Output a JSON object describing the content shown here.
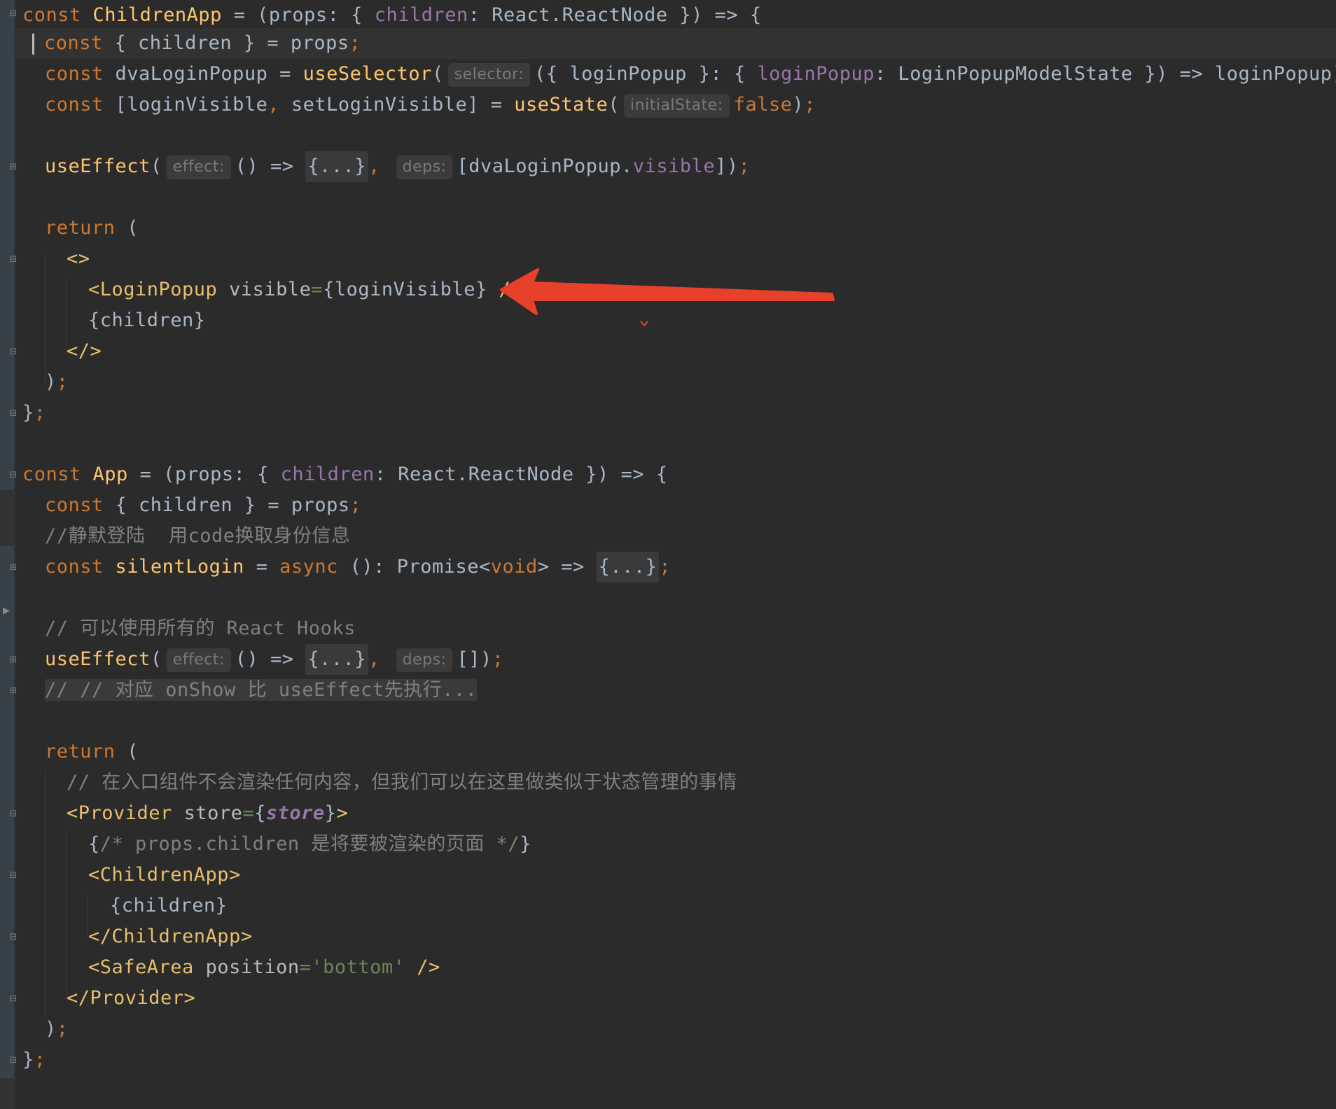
{
  "colors": {
    "background": "#2b2b2b",
    "keyword": "#cc7832",
    "function": "#ffc66d",
    "property": "#9876aa",
    "string": "#6a8759",
    "comment": "#808080",
    "tag": "#e8bf6a",
    "annotation_arrow": "#e8412b"
  },
  "hints": {
    "selector": "selector:",
    "initialState": "initialState:",
    "effect": "effect:",
    "deps": "deps:"
  },
  "code": {
    "l1": {
      "kw": "const",
      "name": "ChildrenApp",
      "a": " = (props: { ",
      "prop": "children",
      "b": ": React.ReactNode }) => {"
    },
    "l2": {
      "kw": "const",
      "a": " { children } = props",
      "semi": ";"
    },
    "l3": {
      "kw": "const",
      "a": " dvaLoginPopup = ",
      "fn": "useSelector",
      "b": "(",
      "c": "({ loginPopup }: { ",
      "prop": "loginPopup",
      "d": ": LoginPopupModelState }) => loginPopup)",
      "semi": ";"
    },
    "l4": {
      "kw": "const",
      "a": " [loginVisible",
      "comma": ",",
      "b": " setLoginVisible] = ",
      "fn": "useState",
      "c": "(",
      "val": "false",
      "d": ")",
      "semi": ";"
    },
    "l5": {
      "fn": "useEffect",
      "a": "(",
      "b": "() => ",
      "folded": "{...}",
      "comma": ",",
      "c": "[dvaLoginPopup.",
      "prop": "visible",
      "d": "])",
      "semi": ";"
    },
    "l6": {
      "kw": "return",
      "a": " ("
    },
    "l7": {
      "tag": "<>"
    },
    "l8": {
      "tag": "<LoginPopup",
      "attr": " visible",
      "eq": "=",
      "a": "{loginVisible}",
      "close": " />"
    },
    "l9": {
      "a": "{children}"
    },
    "l10": {
      "tag": "</>"
    },
    "l11": {
      "a": ")",
      "semi": ";"
    },
    "l12": {
      "a": "}",
      "semi": ";"
    },
    "l13": {
      "kw": "const",
      "name": "App",
      "a": " = (props: { ",
      "prop": "children",
      "b": ": React.ReactNode }) => {"
    },
    "l14": {
      "kw": "const",
      "a": " { children } = props",
      "semi": ";"
    },
    "l15": {
      "cm": "//静默登陆  用code换取身份信息"
    },
    "l16": {
      "kw": "const",
      "name": "silentLogin",
      "a": " = ",
      "async": "async",
      "b": " (): Promise<",
      "void": "void",
      "c": "> => ",
      "folded": "{...}",
      "semi": ";"
    },
    "l17": {
      "cm": "// 可以使用所有的 React Hooks"
    },
    "l18": {
      "fn": "useEffect",
      "a": "(",
      "b": "() => ",
      "folded": "{...}",
      "comma": ",",
      "c": "[])",
      "semi": ";"
    },
    "l19": {
      "cm": "// // 对应 onShow 比 useEffect先执行..."
    },
    "l20": {
      "kw": "return",
      "a": " ("
    },
    "l21": {
      "cm": "// 在入口组件不会渲染任何内容，但我们可以在这里做类似于状态管理的事情"
    },
    "l22": {
      "tag": "<Provider",
      "attr": " store",
      "eq": "=",
      "a": "{",
      "store": "store",
      "b": "}",
      "close": ">"
    },
    "l23": {
      "a": "{",
      "cm": "/* props.children 是将要被渲染的页面 */",
      "b": "}"
    },
    "l24": {
      "tag": "<ChildrenApp>"
    },
    "l25": {
      "a": "{children}"
    },
    "l26": {
      "tag": "</ChildrenApp>"
    },
    "l27": {
      "tag": "<SafeArea",
      "attr": " position",
      "eq": "=",
      "str": "'bottom'",
      "close": " />"
    },
    "l28": {
      "tag": "</Provider>"
    },
    "l29": {
      "a": ")",
      "semi": ";"
    },
    "l30": {
      "a": "}",
      "semi": ";"
    }
  }
}
